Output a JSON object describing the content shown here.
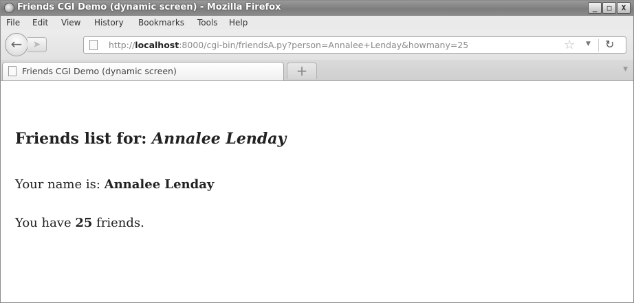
{
  "window": {
    "title": "Friends CGI Demo (dynamic screen) - Mozilla Firefox",
    "controls": {
      "minimize": "_",
      "maximize": "□",
      "close": "X"
    }
  },
  "menu": [
    {
      "label": "File"
    },
    {
      "label": "Edit"
    },
    {
      "label": "View"
    },
    {
      "label": "History"
    },
    {
      "label": "Bookmarks"
    },
    {
      "label": "Tools"
    },
    {
      "label": "Help"
    }
  ],
  "navbar": {
    "url_prefix": "http://",
    "url_host": "localhost",
    "url_rest": ":8000/cgi-bin/friendsA.py?person=Annalee+Lenday&howmany=25",
    "icons": [
      "back-arrow-icon",
      "forward-arrow-icon",
      "page-icon",
      "star-icon",
      "dropmarker-icon",
      "reload-icon"
    ]
  },
  "tabs": [
    {
      "label": "Friends CGI Demo (dynamic screen)",
      "active": true
    }
  ],
  "new_tab_label": "+",
  "page": {
    "heading_prefix": "Friends list for: ",
    "heading_name": "Annalee Lenday",
    "name_prefix": "Your name is: ",
    "name_value": "Annalee Lenday",
    "count_prefix": "You have ",
    "count_value": "25",
    "count_suffix": " friends."
  }
}
